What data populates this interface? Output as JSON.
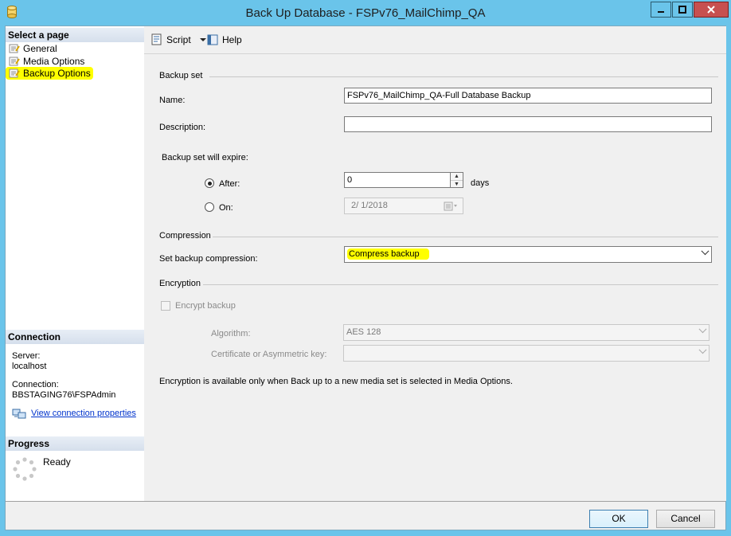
{
  "window": {
    "title": "Back Up Database - FSPv76_MailChimp_QA"
  },
  "left_pane": {
    "select_page_header": "Select a page",
    "pages": [
      {
        "label": "General"
      },
      {
        "label": "Media Options"
      },
      {
        "label": "Backup Options",
        "selected": true
      }
    ],
    "connection_header": "Connection",
    "server_label": "Server:",
    "server_value": "localhost",
    "connection_label": "Connection:",
    "connection_value": "BBSTAGING76\\FSPAdmin",
    "view_connection_link": "View connection properties",
    "progress_header": "Progress",
    "progress_status": "Ready"
  },
  "toolbar": {
    "script_label": "Script",
    "help_label": "Help"
  },
  "backup_set": {
    "group_label": "Backup set",
    "name_label": "Name:",
    "name_value": "FSPv76_MailChimp_QA-Full Database Backup",
    "description_label": "Description:",
    "description_value": "",
    "expire_label": "Backup set will expire:",
    "after_label": "After:",
    "after_value": "0",
    "after_unit": "days",
    "on_label": "On:",
    "on_value": "2/  1/2018",
    "expire_choice": "After"
  },
  "compression": {
    "group_label": "Compression",
    "set_label": "Set backup compression:",
    "selected_value": "Compress backup"
  },
  "encryption": {
    "group_label": "Encryption",
    "encrypt_label": "Encrypt backup",
    "encrypt_checked": false,
    "algorithm_label": "Algorithm:",
    "algorithm_value": "AES 128",
    "certificate_label": "Certificate or Asymmetric key:",
    "certificate_value": "",
    "note": "Encryption is available only when Back up to a new media set is selected in Media Options."
  },
  "buttons": {
    "ok": "OK",
    "cancel": "Cancel"
  },
  "colors": {
    "title_bar": "#6ac4ea",
    "highlight": "#ffff00",
    "close_button": "#c75050",
    "link": "#0033cc"
  }
}
